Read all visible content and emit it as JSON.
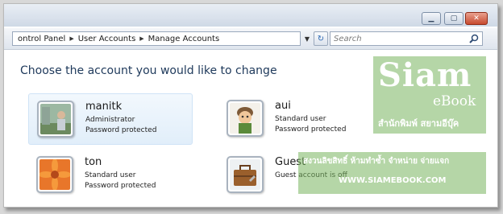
{
  "address": {
    "crumbs": [
      "ontrol Panel",
      "User Accounts",
      "Manage Accounts"
    ],
    "search_placeholder": "Search"
  },
  "page": {
    "heading": "Choose the account you would like to change"
  },
  "accounts": [
    {
      "name": "manitk",
      "type": "Administrator",
      "status": "Password protected",
      "picture": "photo-person-icon"
    },
    {
      "name": "aui",
      "type": "Standard user",
      "status": "Password protected",
      "picture": "cartoon-figure-icon"
    },
    {
      "name": "ton",
      "type": "Standard user",
      "status": "Password protected",
      "picture": "orange-flower-icon"
    },
    {
      "name": "Guest",
      "type": "Guest account is off",
      "status": "",
      "picture": "briefcase-icon"
    }
  ],
  "watermark": {
    "brand": "Siam",
    "sub": "eBook",
    "thai_name": "สำนักพิมพ์ สยามอีบุ๊ค",
    "notice": "สงวนลิขสิทธิ์ ห้ามทำซ้ำ จำหน่าย จ่ายแจก",
    "url": "WWW.SIAMEBOOK.COM"
  },
  "colors": {
    "heading": "#1e395b",
    "selection": "#e1eefa",
    "watermark": "#78b45f"
  }
}
